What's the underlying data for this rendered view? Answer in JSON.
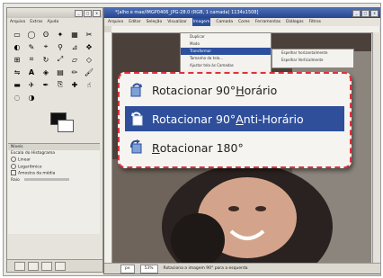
{
  "toolbox": {
    "menu": [
      "Arquivo",
      "Extras",
      "Ajuda"
    ],
    "options_title": "Níveis",
    "options_rows": [
      "Escala do Histograma",
      "Linear",
      "Logarítmico",
      "Amostra da média",
      "Raio"
    ]
  },
  "image_window": {
    "title": "*[alho e mae/IMGP0406_JPG-28.0 (RGB, 1 camada) 1134x1508]",
    "menu": [
      "Arquivo",
      "Editar",
      "Seleção",
      "Visualizar",
      "Imagem",
      "Camada",
      "Cores",
      "Ferramentas",
      "Diálogos",
      "Filtros"
    ],
    "status": {
      "unit": "px",
      "zoom": "53%",
      "message": "Rotaciona a imagem 90° para a esquerda"
    }
  },
  "image_menu": [
    "Duplicar",
    "Modo",
    "Transformar",
    "Tamanho da tela...",
    "Ajustar tela às Camadas"
  ],
  "transform_submenu": [
    "Espelhar horizontalmente",
    "Espelhar Verticalmente"
  ],
  "zoomed_menu": [
    {
      "pre": "Rotacionar 90° ",
      "u": "H",
      "post": "orário",
      "icon": "rotate-clockwise-icon"
    },
    {
      "pre": "Rotacionar 90° ",
      "u": "A",
      "post": "nti-Horário",
      "icon": "rotate-counterclockwise-icon"
    },
    {
      "pre": "",
      "u": "R",
      "post": "otacionar 180°",
      "icon": "rotate-180-icon"
    }
  ]
}
